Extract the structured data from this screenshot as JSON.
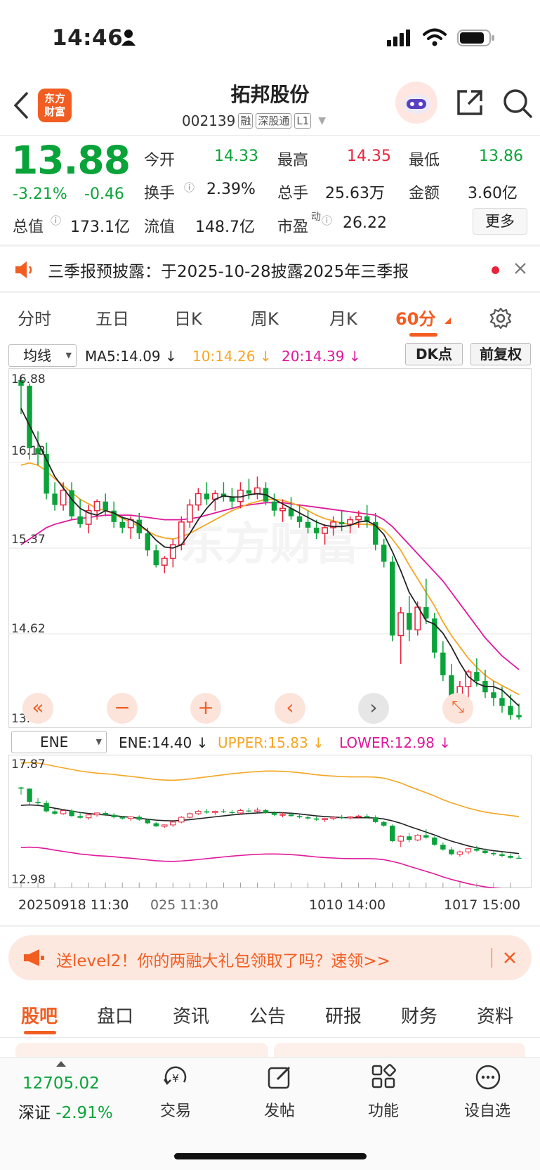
{
  "status_bar": {
    "time": "14:46"
  },
  "header": {
    "logo": "东方\n财富",
    "title": "拓邦股份",
    "code": "002139",
    "tags": [
      "融",
      "深股通",
      "L1"
    ]
  },
  "quote": {
    "price": "13.88",
    "change_pct": "-3.21%",
    "change": "-0.46",
    "open_label": "今开",
    "open": "14.33",
    "high_label": "最高",
    "high": "14.35",
    "low_label": "最低",
    "low": "13.86",
    "turnover_label": "换手",
    "turnover": "2.39%",
    "volume_label": "总手",
    "volume": "25.63万",
    "amount_label": "金额",
    "amount": "3.60亿",
    "mktcap_label": "总值",
    "mktcap": "173.1亿",
    "float_label": "流值",
    "float": "148.7亿",
    "pe_label": "市盈",
    "pe_sup": "动",
    "pe": "26.22",
    "more": "更多"
  },
  "notice": {
    "text": "三季报预披露：于2025-10-28披露2025年三季报"
  },
  "period_tabs": [
    "分时",
    "五日",
    "日K",
    "周K",
    "月K",
    "60分"
  ],
  "active_period": "60分",
  "indicators": {
    "ma_select": "均线",
    "ma5": "MA5:14.09",
    "ma10": "10:14.26",
    "ma20": "20:14.39",
    "dk_button": "DK点",
    "adjust_button": "前复权",
    "ma5_color": "#222222",
    "ma10_color": "#f5a623",
    "ma20_color": "#e0189a"
  },
  "main_axis": [
    "16.88",
    "16.13",
    "15.37",
    "14.62",
    "13.86"
  ],
  "sub_panel": {
    "select": "ENE",
    "ene": "ENE:14.40",
    "upper": "UPPER:15.83",
    "lower": "LOWER:12.98",
    "axis_top": "17.87",
    "axis_bottom": "12.98"
  },
  "time_axis": [
    "20250918 11:30",
    "025 11:30",
    "1010 14:00",
    "1017 15:00"
  ],
  "banner": {
    "text": "送level2！你的两融大礼包领取了吗？速领>>"
  },
  "bottom_tabs": [
    "股吧",
    "盘口",
    "资讯",
    "公告",
    "研报",
    "财务",
    "资料"
  ],
  "bottom_nav": {
    "index_value": "12705.02",
    "index_name": "深证",
    "index_change": "-2.91%",
    "items": [
      "交易",
      "发帖",
      "功能",
      "设自选"
    ]
  },
  "watermark": "东方财富",
  "chart_data": {
    "type": "candlestick",
    "ylim": [
      13.86,
      16.88
    ],
    "candles": [
      [
        16.85,
        16.88,
        16.55,
        16.8
      ],
      [
        16.8,
        16.82,
        16.15,
        16.25
      ],
      [
        16.25,
        16.4,
        16.1,
        16.2
      ],
      [
        16.2,
        16.3,
        15.8,
        15.85
      ],
      [
        15.85,
        15.95,
        15.7,
        15.75
      ],
      [
        15.75,
        15.95,
        15.7,
        15.88
      ],
      [
        15.88,
        15.95,
        15.62,
        15.65
      ],
      [
        15.65,
        15.8,
        15.55,
        15.58
      ],
      [
        15.58,
        15.75,
        15.5,
        15.7
      ],
      [
        15.7,
        15.8,
        15.62,
        15.78
      ],
      [
        15.78,
        15.85,
        15.65,
        15.7
      ],
      [
        15.7,
        15.78,
        15.55,
        15.6
      ],
      [
        15.6,
        15.65,
        15.5,
        15.55
      ],
      [
        15.55,
        15.65,
        15.45,
        15.62
      ],
      [
        15.62,
        15.68,
        15.45,
        15.5
      ],
      [
        15.5,
        15.55,
        15.3,
        15.35
      ],
      [
        15.35,
        15.4,
        15.2,
        15.22
      ],
      [
        15.22,
        15.3,
        15.15,
        15.28
      ],
      [
        15.28,
        15.45,
        15.2,
        15.4
      ],
      [
        15.4,
        15.65,
        15.35,
        15.6
      ],
      [
        15.6,
        15.8,
        15.55,
        15.75
      ],
      [
        15.75,
        15.9,
        15.7,
        15.85
      ],
      [
        15.85,
        15.95,
        15.75,
        15.8
      ],
      [
        15.8,
        15.88,
        15.7,
        15.85
      ],
      [
        15.85,
        15.95,
        15.78,
        15.82
      ],
      [
        15.82,
        15.9,
        15.72,
        15.78
      ],
      [
        15.78,
        15.95,
        15.72,
        15.88
      ],
      [
        15.88,
        15.98,
        15.8,
        15.85
      ],
      [
        15.85,
        16.0,
        15.8,
        15.9
      ],
      [
        15.9,
        15.95,
        15.75,
        15.78
      ],
      [
        15.78,
        15.85,
        15.65,
        15.7
      ],
      [
        15.7,
        15.8,
        15.6,
        15.72
      ],
      [
        15.72,
        15.82,
        15.62,
        15.65
      ],
      [
        15.65,
        15.75,
        15.55,
        15.6
      ],
      [
        15.6,
        15.7,
        15.5,
        15.55
      ],
      [
        15.55,
        15.62,
        15.45,
        15.5
      ],
      [
        15.5,
        15.58,
        15.4,
        15.55
      ],
      [
        15.55,
        15.65,
        15.48,
        15.6
      ],
      [
        15.6,
        15.7,
        15.52,
        15.58
      ],
      [
        15.58,
        15.65,
        15.5,
        15.62
      ],
      [
        15.62,
        15.7,
        15.55,
        15.65
      ],
      [
        15.65,
        15.75,
        15.55,
        15.6
      ],
      [
        15.6,
        15.68,
        15.35,
        15.4
      ],
      [
        15.4,
        15.45,
        15.2,
        15.25
      ],
      [
        15.25,
        15.3,
        14.55,
        14.6
      ],
      [
        14.6,
        14.85,
        14.35,
        14.8
      ],
      [
        14.8,
        14.95,
        14.55,
        14.65
      ],
      [
        14.65,
        14.9,
        14.6,
        14.85
      ],
      [
        14.85,
        15.1,
        14.7,
        14.75
      ],
      [
        14.75,
        14.8,
        14.4,
        14.45
      ],
      [
        14.45,
        14.55,
        14.2,
        14.25
      ],
      [
        14.25,
        14.35,
        14.0,
        14.05
      ],
      [
        14.05,
        14.2,
        13.95,
        14.15
      ],
      [
        14.15,
        14.3,
        14.05,
        14.28
      ],
      [
        14.28,
        14.4,
        14.15,
        14.2
      ],
      [
        14.2,
        14.3,
        14.05,
        14.1
      ],
      [
        14.1,
        14.2,
        13.98,
        14.05
      ],
      [
        14.05,
        14.15,
        13.92,
        13.98
      ],
      [
        13.98,
        14.08,
        13.86,
        13.9
      ],
      [
        13.9,
        14.0,
        13.86,
        13.88
      ]
    ],
    "ma5": [
      16.6,
      16.45,
      16.3,
      16.15,
      16.0,
      15.9,
      15.8,
      15.72,
      15.68,
      15.66,
      15.7,
      15.68,
      15.64,
      15.62,
      15.58,
      15.52,
      15.44,
      15.38,
      15.37,
      15.4,
      15.5,
      15.62,
      15.72,
      15.8,
      15.83,
      15.82,
      15.82,
      15.84,
      15.85,
      15.84,
      15.8,
      15.76,
      15.72,
      15.68,
      15.64,
      15.6,
      15.57,
      15.56,
      15.56,
      15.57,
      15.6,
      15.61,
      15.57,
      15.49,
      15.34,
      15.17,
      14.98,
      14.86,
      14.73,
      14.7,
      14.62,
      14.5,
      14.36,
      14.24,
      14.18,
      14.15,
      14.15,
      14.12,
      14.05,
      13.98
    ],
    "ma10": [
      16.1,
      16.12,
      16.1,
      16.05,
      15.98,
      15.92,
      15.86,
      15.8,
      15.76,
      15.72,
      15.7,
      15.67,
      15.63,
      15.6,
      15.56,
      15.52,
      15.48,
      15.46,
      15.45,
      15.47,
      15.5,
      15.54,
      15.58,
      15.62,
      15.66,
      15.7,
      15.73,
      15.76,
      15.78,
      15.8,
      15.8,
      15.79,
      15.77,
      15.74,
      15.7,
      15.66,
      15.63,
      15.61,
      15.59,
      15.58,
      15.58,
      15.58,
      15.57,
      15.53,
      15.45,
      15.35,
      15.22,
      15.1,
      14.98,
      14.86,
      14.72,
      14.6,
      14.5,
      14.4,
      14.32,
      14.25,
      14.2,
      14.16,
      14.12,
      14.08
    ],
    "ma20": [
      15.4,
      15.45,
      15.5,
      15.55,
      15.58,
      15.6,
      15.62,
      15.63,
      15.64,
      15.65,
      15.66,
      15.66,
      15.66,
      15.66,
      15.65,
      15.64,
      15.63,
      15.62,
      15.62,
      15.62,
      15.63,
      15.64,
      15.66,
      15.68,
      15.7,
      15.72,
      15.74,
      15.75,
      15.76,
      15.77,
      15.77,
      15.77,
      15.76,
      15.75,
      15.74,
      15.73,
      15.72,
      15.71,
      15.7,
      15.69,
      15.68,
      15.67,
      15.66,
      15.62,
      15.56,
      15.48,
      15.4,
      15.32,
      15.24,
      15.16,
      15.08,
      14.98,
      14.88,
      14.78,
      14.68,
      14.58,
      14.5,
      14.42,
      14.36,
      14.3
    ]
  }
}
